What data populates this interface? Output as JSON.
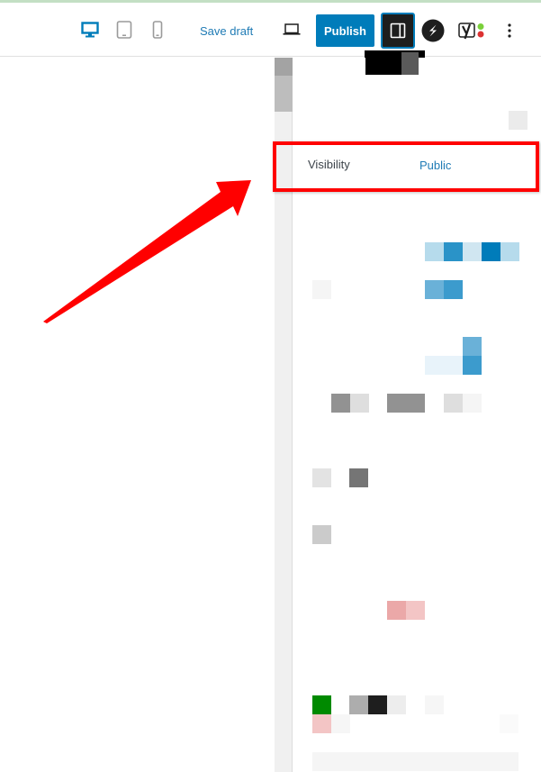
{
  "header": {
    "device_preview": [
      {
        "name": "desktop",
        "icon": "desktop-icon",
        "active": true
      },
      {
        "name": "tablet",
        "icon": "tablet-icon",
        "active": false
      },
      {
        "name": "mobile",
        "icon": "mobile-icon",
        "active": false
      }
    ],
    "save_draft_label": "Save draft",
    "preview_icon": "laptop-icon",
    "publish_label": "Publish",
    "settings_icon": "sidebar-toggle-icon",
    "plugin_icon": "s-plugin-icon",
    "seo_icon": "yoast-seo-icon",
    "more_icon": "more-vertical-icon"
  },
  "sidebar": {
    "rows": [
      {
        "label": "Visibility",
        "value": "Public"
      }
    ]
  },
  "annotation": {
    "highlight_color": "#ff0000",
    "arrow_color": "#ff0000"
  },
  "colors": {
    "accent": "#007cba",
    "link": "#1f7bb5",
    "top_accent": "#c3dfc4",
    "seo_good": "#7ad03a",
    "seo_bad": "#dc3232"
  }
}
